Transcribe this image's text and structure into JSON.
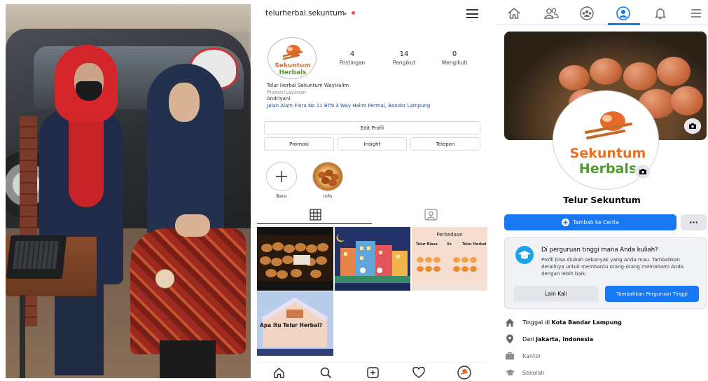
{
  "instagram": {
    "username": "telurherbal.sekuntum",
    "stats": [
      {
        "count": "4",
        "label": "Postingan"
      },
      {
        "count": "14",
        "label": "Pengikut"
      },
      {
        "count": "0",
        "label": "Mengikuti"
      }
    ],
    "bio": {
      "name": "Telur Herbal Sekuntum WayHalim",
      "category": "Produk/Layanan",
      "person": "Andriyani",
      "address": "Jalan Alam Flora No 11 BTN 3 Way Halim Permai, Bandar Lampung"
    },
    "buttons": {
      "edit_profile": "Edit Profil",
      "promote": "Promosi",
      "insight": "Insight",
      "phone": "Telepon"
    },
    "highlights": [
      {
        "label": "Baru"
      },
      {
        "label": "info"
      }
    ],
    "posts": {
      "comparison_title": "Perbedaan",
      "comparison_left": "Telur Biasa",
      "comparison_vs": "Vs",
      "comparison_right": "Telur Herbal",
      "question_title": "Apa Itu Telur Herbal?"
    },
    "logo": {
      "line1": "Sekuntum",
      "line2": "Herbals"
    }
  },
  "facebook": {
    "page_name": "Telur Sekuntum",
    "add_story": "Tambah ke Cerita",
    "more": "···",
    "education_card": {
      "question": "Di perguruan tinggi mana Anda kuliah?",
      "description": "Profil bisa diubah sebanyak yang Anda mau. Tambahkan detailnya untuk membantu orang-orang memahami Anda dengan lebih baik.",
      "later": "Lain Kali",
      "add": "Tambahkan Perguruan Tinggi"
    },
    "info": {
      "lives_prefix": "Tinggal di ",
      "lives_city": "Kota Bandar Lampung",
      "from_prefix": "Dari ",
      "from_city": "Jakarta, Indonesia",
      "work": "Kantor",
      "school": "Sekolah"
    },
    "logo": {
      "line1": "Sekuntum",
      "line2": "Herbals"
    },
    "colors": {
      "accent": "#1877f2"
    }
  }
}
